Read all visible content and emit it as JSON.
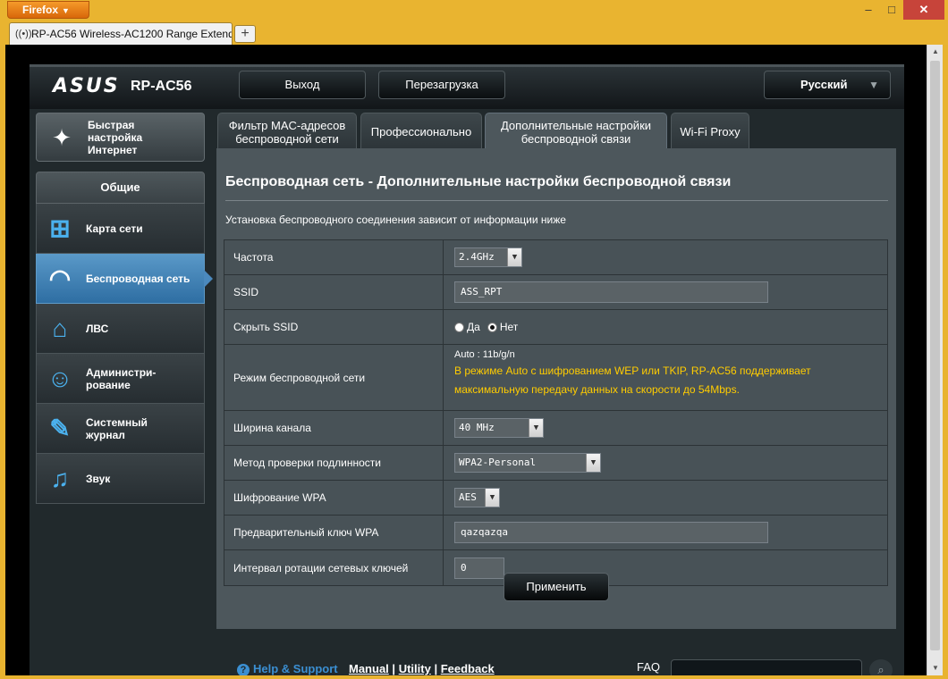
{
  "browser": {
    "menu_label": "Firefox",
    "tab_title": "RP-AC56 Wireless-AC1200 Range Extend...",
    "new_tab": "+"
  },
  "header": {
    "brand": "ASUS",
    "model": "RP-AC56",
    "logout": "Выход",
    "reboot": "Перезагрузка",
    "language": "Русский"
  },
  "sidebar": {
    "quick_setup": "Быстрая\nнастройка\nИнтернет",
    "section_title": "Общие",
    "items": [
      {
        "label": "Карта сети",
        "icon": "network-map-icon"
      },
      {
        "label": "Беспроводная сеть",
        "icon": "wifi-icon",
        "active": true
      },
      {
        "label": "ЛВС",
        "icon": "home-icon"
      },
      {
        "label": "Администри-\nрование",
        "icon": "admin-user-icon"
      },
      {
        "label": "Системный\nжурнал",
        "icon": "system-log-icon"
      },
      {
        "label": "Звук",
        "icon": "music-note-icon"
      }
    ]
  },
  "tabs": [
    {
      "label": "Фильтр MAC-адресов беспроводной сети"
    },
    {
      "label": "Профессионально"
    },
    {
      "label": "Дополнительные настройки беспроводной связи",
      "active": true
    },
    {
      "label": "Wi-Fi Proxy"
    }
  ],
  "main": {
    "title": "Беспроводная сеть - Дополнительные настройки беспроводной связи",
    "description": "Установка беспроводного соединения зависит от информации ниже",
    "fields": {
      "frequency": {
        "label": "Частота",
        "value": "2.4GHz"
      },
      "ssid": {
        "label": "SSID",
        "value": "ASS_RPT"
      },
      "hide_ssid": {
        "label": "Скрыть SSID",
        "yes": "Да",
        "no": "Нет",
        "selected": "Нет"
      },
      "wireless_mode": {
        "label": "Режим беспроводной сети",
        "value": "Auto : 11b/g/n",
        "note": "В режиме Auto с шифрованием WEP или TKIP, RP-AC56 поддерживает максимальную передачу данных на скорости до 54Mbps."
      },
      "channel_width": {
        "label": "Ширина канала",
        "value": "40 MHz"
      },
      "auth_method": {
        "label": "Метод проверки подлинности",
        "value": "WPA2-Personal"
      },
      "wpa_encryption": {
        "label": "Шифрование WPA",
        "value": "AES"
      },
      "wpa_key": {
        "label": "Предварительный ключ WPA",
        "value": "qazqazqa"
      },
      "key_rotation": {
        "label": "Интервал ротации сетевых ключей",
        "value": "0"
      }
    },
    "apply": "Применить"
  },
  "footer": {
    "help": "Help & Support",
    "manual": "Manual",
    "utility": "Utility",
    "feedback": "Feedback",
    "sep": "|",
    "faq": "FAQ"
  },
  "colors": {
    "accent_active": "#2e6ea3",
    "warning_text": "#ffcc00",
    "help_link": "#3b8fd2"
  }
}
